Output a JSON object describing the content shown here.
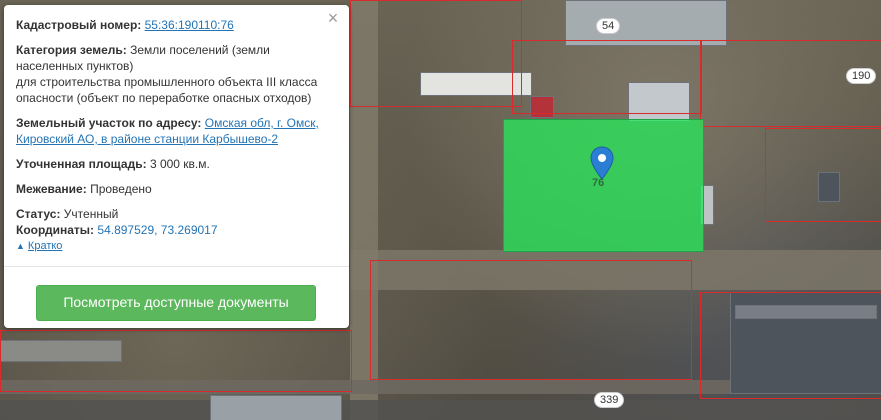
{
  "popup": {
    "cadastral_label": "Кадастровый номер:",
    "cadastral_value": "55:36:190110:76",
    "category_label": "Категория земель:",
    "category_value": "Земли поселений (земли населенных пунктов)",
    "category_purpose": "для строительства промышленного объекта III класса опасности (объект по переработке опасных отходов)",
    "address_label": "Земельный участок по адресу:",
    "address_value": "Омская обл, г. Омск, Кировский АО, в районе станции Карбышево-2",
    "area_label": "Уточненная площадь:",
    "area_value": "3 000 кв.м.",
    "survey_label": "Межевание:",
    "survey_value": "Проведено",
    "status_label": "Статус:",
    "status_value": "Учтенный",
    "coords_label": "Координаты:",
    "coords_value": "54.897529, 73.269017",
    "collapse_label": "Кратко",
    "docs_button": "Посмотреть доступные документы",
    "close_icon": "close-icon"
  },
  "map": {
    "parcel_labels": [
      "54",
      "190",
      "339"
    ],
    "selected_parcel_number": "76",
    "marker_icon": "map-pin-icon",
    "selected_color": "#28e65a",
    "boundary_color": "#d92b2b"
  }
}
